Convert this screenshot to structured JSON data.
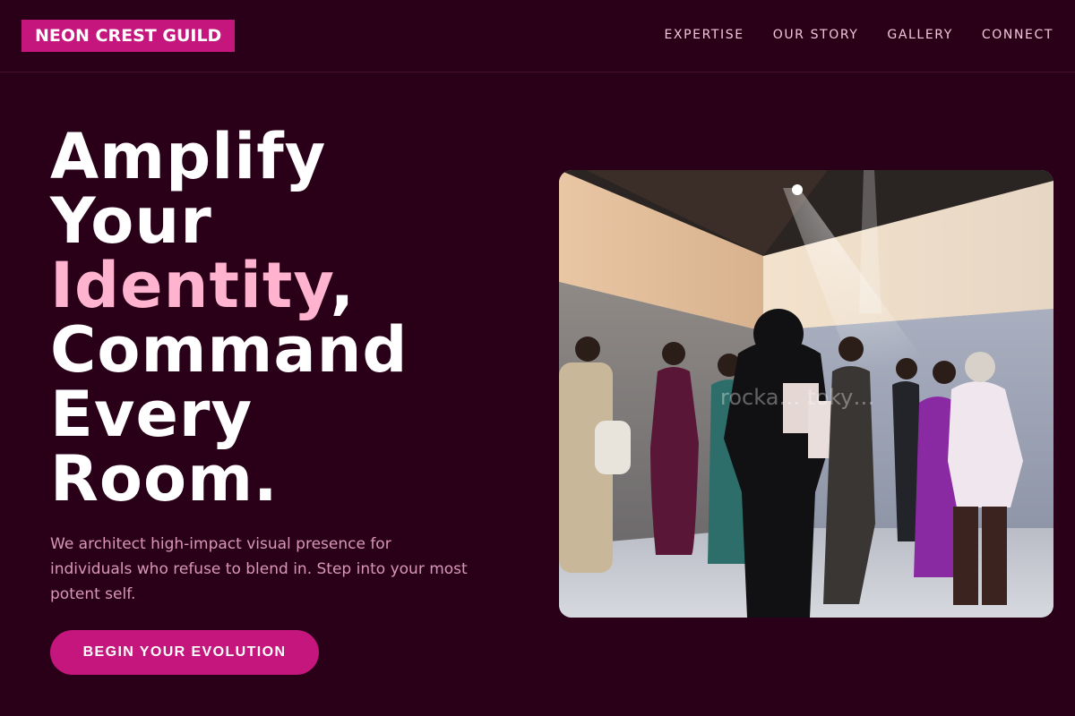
{
  "brand": {
    "name": "NEON CREST GUILD"
  },
  "nav": {
    "items": [
      {
        "label": "EXPERTISE"
      },
      {
        "label": "OUR STORY"
      },
      {
        "label": "GALLERY"
      },
      {
        "label": "CONNECT"
      }
    ]
  },
  "hero": {
    "title_line1": "Amplify",
    "title_line2": "Your",
    "title_accent": "Identity",
    "title_comma": ",",
    "title_line4": "Command",
    "title_line5": "Every",
    "title_line6": "Room.",
    "description": "We architect high-impact visual presence for individuals who refuse to blend in. Step into your most potent self.",
    "cta_label": "BEGIN YOUR EVOLUTION"
  },
  "image": {
    "watermark": "rocka… toky…"
  },
  "colors": {
    "background": "#2a0019",
    "accent": "#c4167c",
    "title_accent": "#ffb3cf",
    "body_text": "#d896b9",
    "nav_text": "#f0c6d9"
  }
}
